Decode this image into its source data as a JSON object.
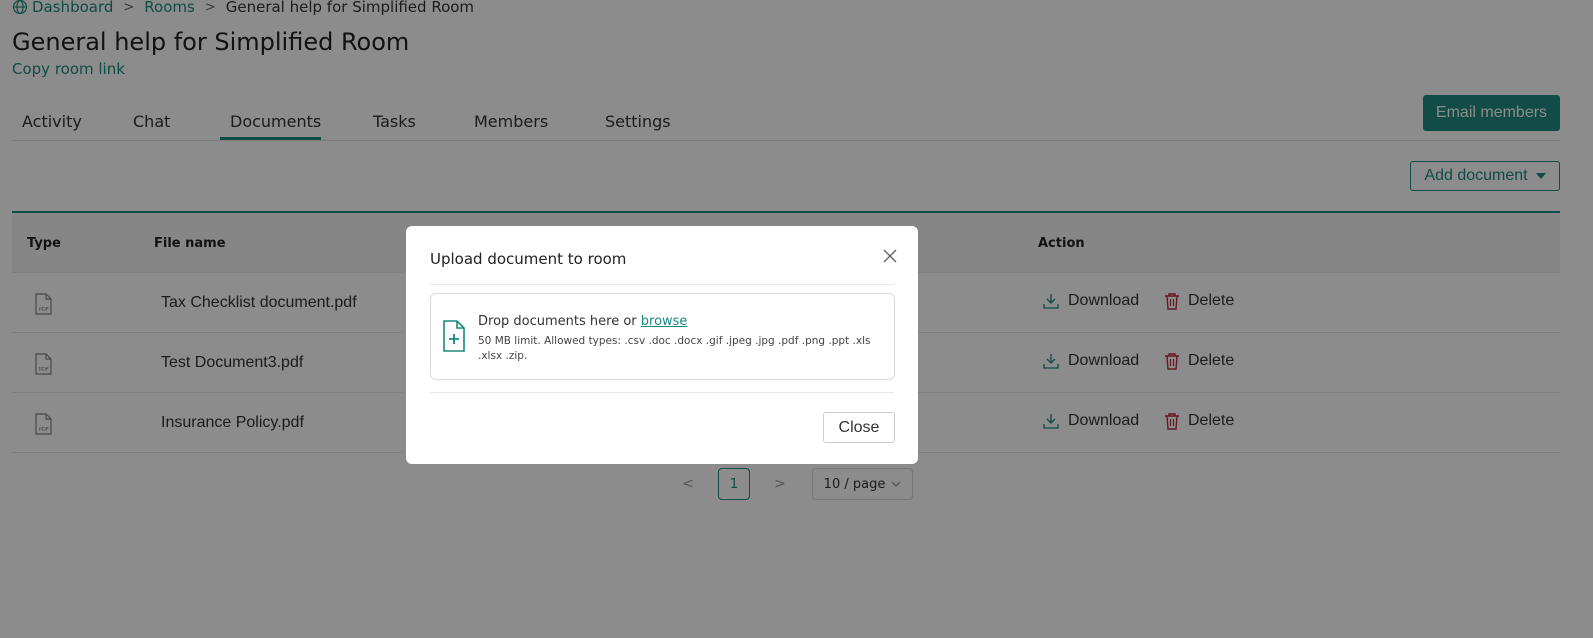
{
  "breadcrumb": {
    "items": [
      "Dashboard",
      "Rooms",
      "General help for Simplified Room"
    ],
    "separator": ">"
  },
  "page": {
    "title": "General help for Simplified Room",
    "copy_link": "Copy room link"
  },
  "tabs": [
    {
      "label": "Activity"
    },
    {
      "label": "Chat"
    },
    {
      "label": "Documents",
      "active": true
    },
    {
      "label": "Tasks"
    },
    {
      "label": "Members"
    },
    {
      "label": "Settings"
    }
  ],
  "buttons": {
    "email_members": "Email members",
    "add_document": "Add document"
  },
  "table": {
    "columns": [
      "Type",
      "File name",
      "Action"
    ],
    "rows": [
      {
        "type": "PDF",
        "name": "Tax Checklist document.pdf"
      },
      {
        "type": "PDF",
        "name": "Test Document3.pdf"
      },
      {
        "type": "PDF",
        "name": "Insurance Policy.pdf"
      }
    ],
    "actions": {
      "download": "Download",
      "delete": "Delete"
    }
  },
  "pagination": {
    "current_page": "1",
    "page_size": "10 / page",
    "prev": "<",
    "next": ">"
  },
  "modal": {
    "title": "Upload document to room",
    "drop_text": "Drop documents here or ",
    "browse_link": "browse",
    "limits": "50 MB limit. Allowed types: .csv .doc .docx .gif .jpeg .jpg .pdf .png .ppt .xls .xlsx .zip.",
    "close_button": "Close"
  },
  "colors": {
    "accent": "#1a8a80",
    "danger": "#c0283c"
  },
  "icons": {
    "breadcrumb": "globe-icon",
    "dropzone": "file-plus-icon",
    "row_type": "pdf-icon",
    "download": "download-icon",
    "delete": "trash-icon",
    "modal_close": "close-icon"
  }
}
